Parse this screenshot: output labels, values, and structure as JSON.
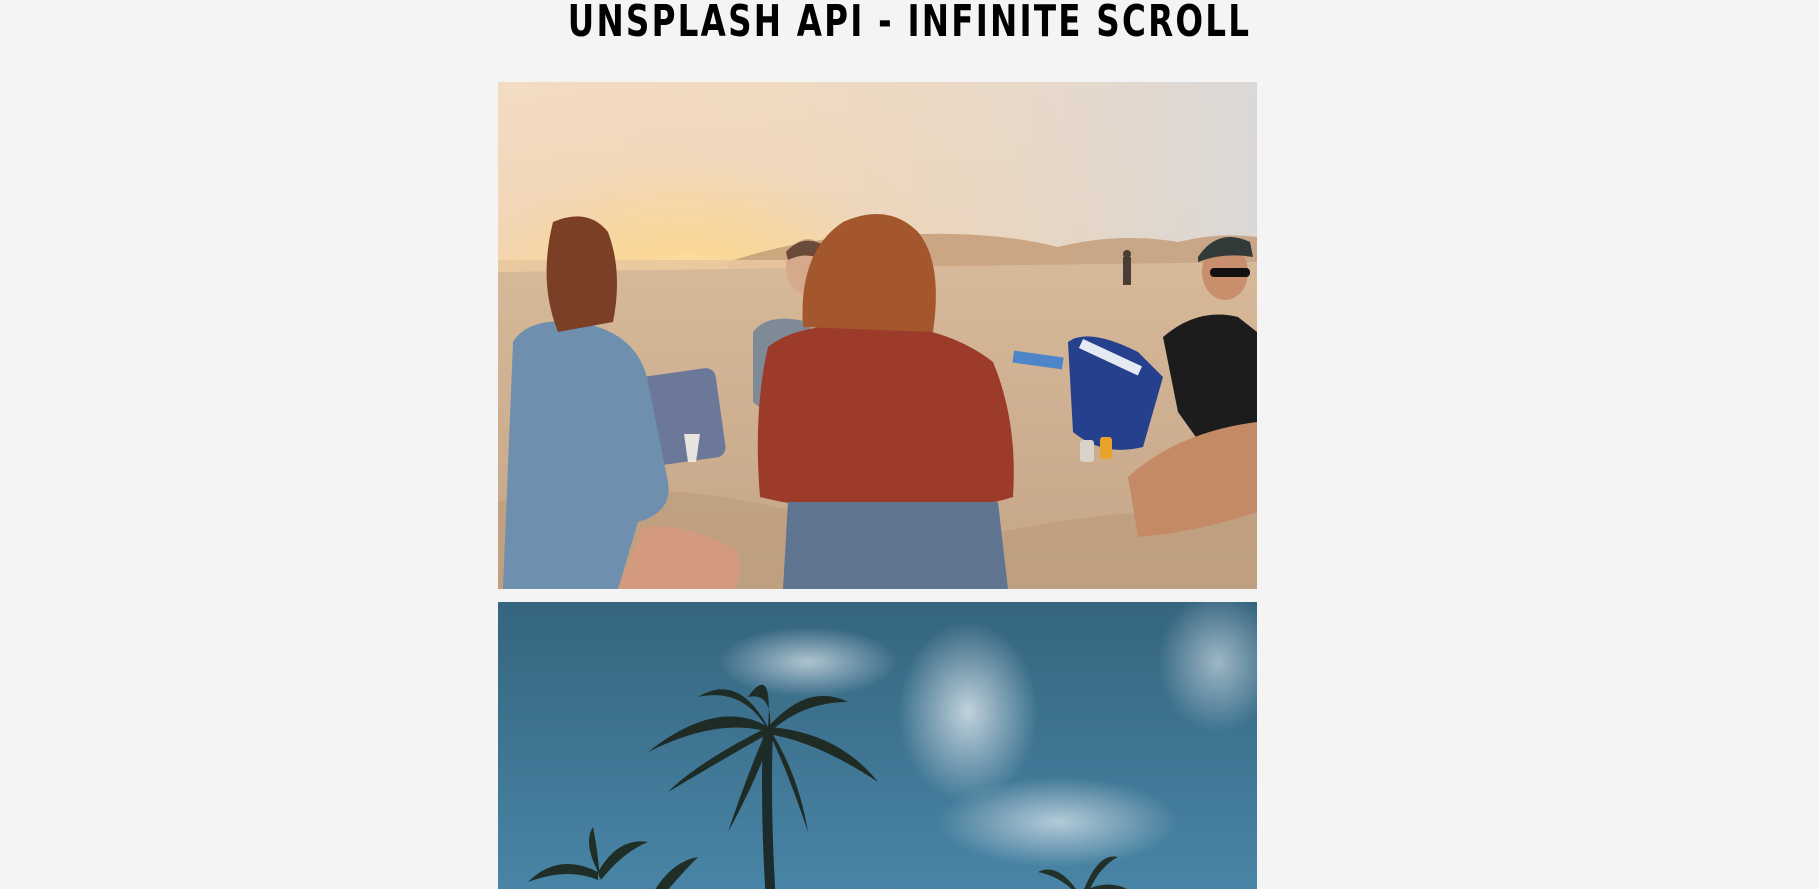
{
  "header": {
    "title": "UNSPLASH API - INFINITE SCROLL"
  },
  "gallery": {
    "photos": [
      {
        "name": "beach-sunset-photo"
      },
      {
        "name": "palm-trees-sky-photo"
      }
    ]
  },
  "colors": {
    "page_background": "#f4f4f4",
    "title_color": "#000000"
  }
}
